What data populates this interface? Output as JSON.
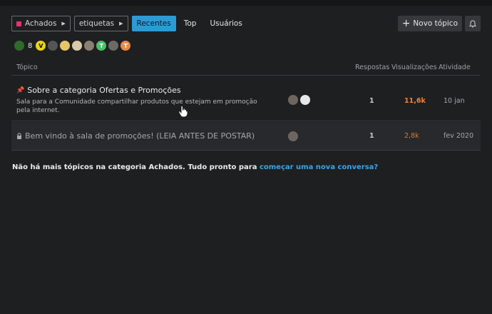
{
  "nav": {
    "category": "Achados",
    "tags": "etiquetas",
    "tabs": [
      "Recentes",
      "Top",
      "Usuários"
    ],
    "new_topic": "Novo tópico"
  },
  "online": {
    "count": "8",
    "avatar_letters": [
      "",
      "",
      "",
      "",
      "",
      "",
      "T",
      "",
      "T"
    ]
  },
  "columns": {
    "topic": "Tópico",
    "replies": "Respostas",
    "views": "Visualizações",
    "activity": "Atividade"
  },
  "topics": [
    {
      "title": "Sobre a categoria Ofertas e Promoções",
      "excerpt": "Sala para a Comunidade compartilhar produtos que estejam em promoção pela internet.",
      "replies": "1",
      "views": "11,6k",
      "activity": "10 jan"
    },
    {
      "title": "Bem vindo à sala de promoções! (LEIA ANTES DE POSTAR)",
      "replies": "1",
      "views": "2,8k",
      "activity": "fev 2020"
    }
  ],
  "footer": {
    "text": "Não há mais tópicos na categoria Achados. Tudo pronto para ",
    "link": "começar uma nova conversa?"
  },
  "colors": {
    "accent": "#2d9ad6",
    "views": "#f0833a",
    "category": "#e0356c"
  }
}
